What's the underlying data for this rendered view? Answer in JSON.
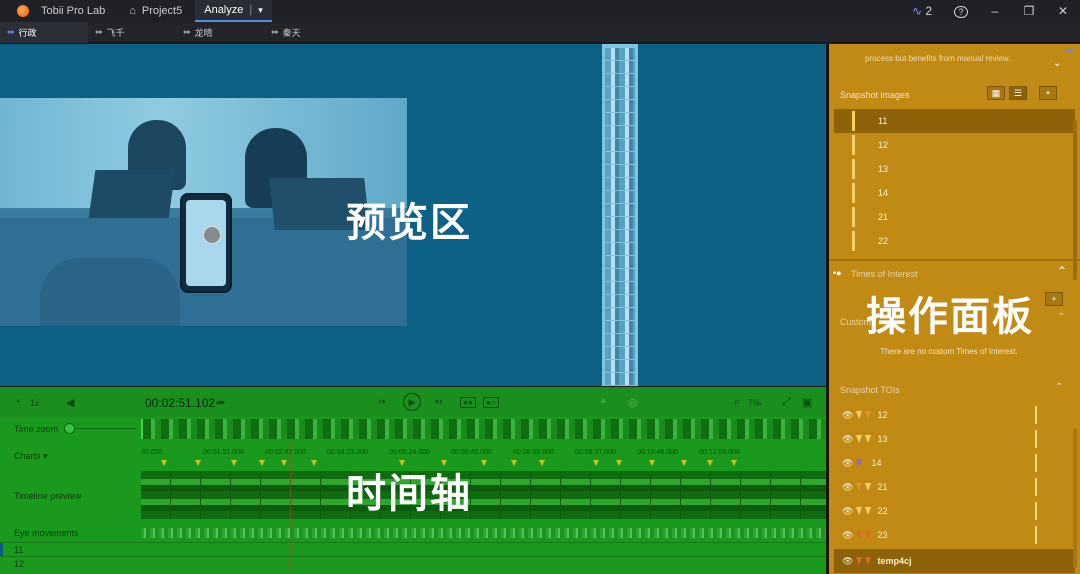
{
  "titlebar": {
    "app_name": "Tobii Pro Lab",
    "project_name": "Project5",
    "analyze_label": "Analyze",
    "analyze_dropdown": "▾",
    "activity_count": "2",
    "help": "?",
    "minimize": "–",
    "restore": "❐",
    "close": "✕"
  },
  "subtabs": [
    {
      "label": "行政",
      "active": true
    },
    {
      "label": "飞千",
      "active": false
    },
    {
      "label": "龙晴",
      "active": false
    },
    {
      "label": "秦天",
      "active": false
    }
  ],
  "preview": {
    "zone_label": "预览区"
  },
  "timeline": {
    "zone_label": "时间轴",
    "speed": "1x",
    "current_time": "00:02:51.102",
    "zoom_pct": "7%",
    "time_zoom_label": "Time zoom",
    "charts_label": "Charts",
    "timeline_preview_label": "Timeline preview",
    "eye_movements_label": "Eye movements",
    "rows": [
      "11",
      "12"
    ],
    "ticks": [
      "00:00:000",
      "00:01:21.000",
      "00:02:42.000",
      "00:04:03.000",
      "00:05:24.000",
      "00:06:45.000",
      "00:08:06.000",
      "00:09:27.000",
      "00:10:48.000",
      "00:12:09.000"
    ],
    "ticks_display": [
      "30.000",
      "00:01:21.000",
      "00:02:42.000",
      "00:04:03.000",
      "00:05:24.000",
      "00:06:45.000",
      "00:08:06.000",
      "00:09:27.000",
      "00:10:48.000",
      "00:12:09.000"
    ]
  },
  "panel": {
    "zone_label": "操作面板",
    "review_text": "process but benefits from manual review.",
    "snapshot_images_label": "Snapshot images",
    "snapshot_images": [
      "11",
      "12",
      "13",
      "14",
      "21",
      "22"
    ],
    "times_of_interest_label": "Times of Interest",
    "custom_label": "Custom",
    "no_custom_text": "There are no custom Times of Interest.",
    "snapshot_tois_label": "Snapshot TOIs",
    "snapshot_tois": [
      "12",
      "13",
      "14",
      "21",
      "22",
      "23",
      "temp4cj"
    ],
    "add": "+"
  }
}
